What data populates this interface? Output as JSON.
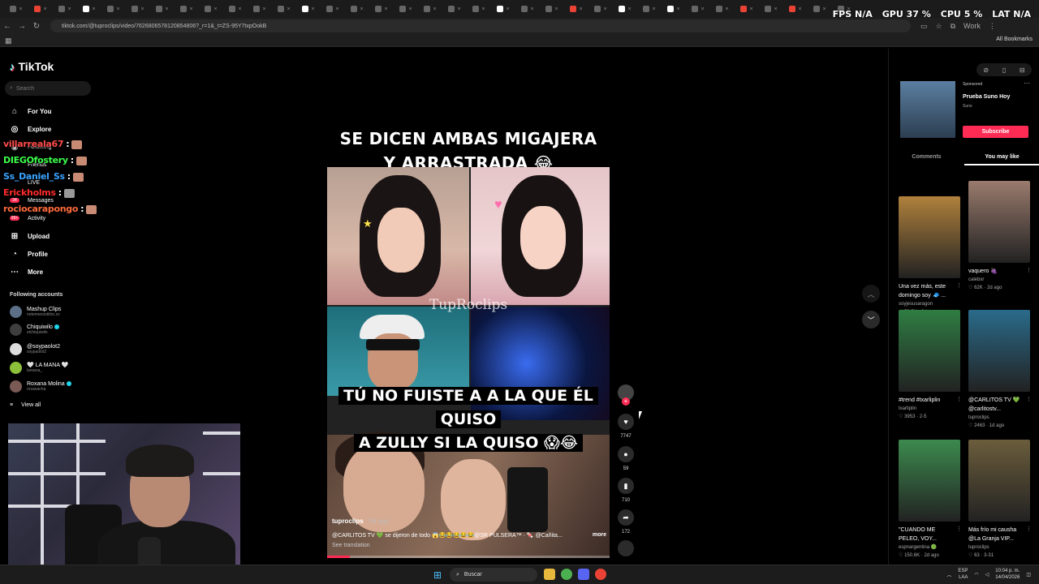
{
  "overlay_stats": {
    "fps_label": "FPS",
    "fps": "N/A",
    "gpu_label": "GPU",
    "gpu": "37 %",
    "cpu_label": "CPU",
    "cpu": "5 %",
    "lat_label": "LAT",
    "lat": "N/A"
  },
  "browser": {
    "url": "tiktok.com/@tuproclips/video/7626806578120854806?_r=1&_t=ZS-95Y7txpOokB",
    "all_bookmarks": "All Bookmarks",
    "profile_label": "Work"
  },
  "sidebar": {
    "logo": "TikTok",
    "search_placeholder": "Search",
    "menu": [
      {
        "label": "For You",
        "icon": "home-icon"
      },
      {
        "label": "Explore",
        "icon": "compass-icon"
      },
      {
        "label": "Following",
        "icon": "following-icon"
      },
      {
        "label": "Friends",
        "icon": "friends-icon"
      },
      {
        "label": "LIVE",
        "icon": "live-icon"
      },
      {
        "label": "Messages",
        "icon": "messages-icon"
      },
      {
        "label": "Activity",
        "icon": "activity-icon"
      },
      {
        "label": "Upload",
        "icon": "upload-icon"
      },
      {
        "label": "Profile",
        "icon": "profile-icon"
      },
      {
        "label": "More",
        "icon": "more-icon"
      }
    ],
    "messages_badge": "34",
    "activity_badge": "99+",
    "following_header": "Following accounts",
    "accounts": [
      {
        "name": "Mashup Clips",
        "handle": "notemenostitiro.zs",
        "verified": false
      },
      {
        "name": "Chiquiwilo",
        "handle": "elchiquiwilo",
        "verified": true
      },
      {
        "name": "@soypaolot2",
        "handle": "soypaolot2",
        "verified": false
      },
      {
        "name": "🤍 LA MANA 🤍",
        "handle": "lamana_",
        "verified": false
      },
      {
        "name": "Roxana Molina",
        "handle": "roxanacha",
        "verified": true
      }
    ],
    "view_all": "View all"
  },
  "chat": [
    {
      "user": "villarreala67",
      "color": "#ff4b4b",
      "suffix": ":"
    },
    {
      "user": "DIEGOfostery",
      "color": "#3cff4a",
      "suffix": ":"
    },
    {
      "user": "Ss_Daniel_Ss",
      "color": "#3aa3ff",
      "suffix": ":"
    },
    {
      "user": "Erickholms",
      "color": "#ff2a2a",
      "suffix": ":"
    },
    {
      "user": "rociocarapongo",
      "color": "#ff6a3c",
      "suffix": ":"
    }
  ],
  "video": {
    "caption_top_line1": "SE DICEN AMBAS MIGAJERA",
    "caption_top_line2": "Y ARRASTRADA 😂",
    "watermark": "TupRoclips",
    "caption_mid_line1": "TÚ NO FUISTE A A LA QUE ÉL QUISO",
    "caption_mid_line2": "A ZULLY SI LA QUISO 😱😂",
    "author": "tuproclips",
    "date": "· 5d ago",
    "description": "@CARLITOS TV 💚 se dijeron de todo 😱😂😂😂😂😂@SR PULSERA™ · 🍬 @Cañita...",
    "more": "more",
    "see_translation": "See translation",
    "progress": 0.08
  },
  "actions": {
    "likes": "7747",
    "comments": "59",
    "saves": "710",
    "shares": "172"
  },
  "right_panel": {
    "sponsored": "Sponsored",
    "sponsor_title": "Prueba Suno Hoy",
    "sponsor_brand": "Suno",
    "subscribe": "Subscribe",
    "tab_comments": "Comments",
    "tab_you_may_like": "You may like",
    "cards": [
      {
        "title": "Una vez más, este domingo soy 🧢 ...",
        "handle": "soyjesusaragon",
        "likes": "70.5K",
        "age": "3d ago",
        "bg": "#b0813c"
      },
      {
        "title": "vaquero 🍇",
        "handle": "calebxr",
        "likes": "62K",
        "age": "2d ago",
        "bg": "#9a7b6d"
      },
      {
        "title": "#trend #txarliplin",
        "handle": "txarliplin",
        "likes": "3953",
        "age": "2-5",
        "bg": "#2f7d43"
      },
      {
        "title": "@CARLITOS TV 💚 @carlitostv...",
        "handle": "tuproclips",
        "likes": "2463",
        "age": "1d ago",
        "bg": "#2a6b8a"
      },
      {
        "title": "\"CUANDO ME PELEO, VOY...",
        "handle": "espnargentina 🟢",
        "likes": "150.6K",
        "age": "2d ago",
        "bg": "#3c8a4e"
      },
      {
        "title": "Más frío mi causha @La Granja VIP...",
        "handle": "tuproclips",
        "likes": "63",
        "age": "3-31",
        "bg": "#6b5d3c"
      }
    ]
  },
  "taskbar": {
    "search": "Buscar",
    "lang1": "ESP",
    "lang2": "LAA",
    "time": "10:04 p. m.",
    "date": "14/04/2026"
  }
}
